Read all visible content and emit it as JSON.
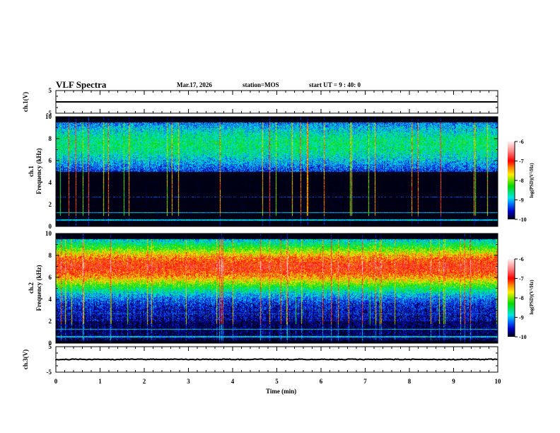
{
  "header": {
    "title": "VLF Spectra",
    "date": "Mar.17, 2026",
    "station": "station=MOS",
    "start": "start  UT =   9 : 40: 0"
  },
  "chart_data": [
    {
      "type": "line",
      "name": "ch1-waveform",
      "ylabel": "ch.1(V)",
      "ylim": [
        -5,
        5
      ],
      "yticks": [
        "5",
        "-5"
      ],
      "value_approx": 0
    },
    {
      "type": "heatmap",
      "name": "ch1-spectrogram",
      "ylabel": "ch.1\nFrequency (kHz)",
      "ylim": [
        0,
        10
      ],
      "yticks": [
        "0",
        "2",
        "4",
        "6",
        "8",
        "10"
      ],
      "band_khz": [
        5,
        9.5
      ],
      "colorbar": {
        "label": "log(PSD)(V²/Hz)",
        "range": [
          -10,
          -6
        ],
        "ticks": [
          "-6",
          "-7",
          "-8",
          "-9",
          "-10"
        ]
      }
    },
    {
      "type": "heatmap",
      "name": "ch2-spectrogram",
      "ylabel": "ch.2\nFrequency (kHz)",
      "ylim": [
        0,
        10
      ],
      "yticks": [
        "0",
        "2",
        "4",
        "6",
        "8",
        "10"
      ],
      "band_khz": [
        2,
        9.5
      ],
      "peak_khz": 7,
      "colorbar": {
        "label": "log(PSD)(V²/Hz)",
        "range": [
          -10,
          -6
        ],
        "ticks": [
          "-6",
          "-7",
          "-8",
          "-9",
          "-10"
        ]
      }
    },
    {
      "type": "line",
      "name": "ch3-waveform",
      "ylabel": "ch.3(V)",
      "ylim": [
        -5,
        5
      ],
      "yticks": [
        "5",
        "-5"
      ],
      "value_approx": 0
    }
  ],
  "xaxis": {
    "label": "Time  (min)",
    "xlim": [
      0,
      10
    ],
    "ticks": [
      "0",
      "1",
      "2",
      "3",
      "4",
      "5",
      "6",
      "7",
      "8",
      "9",
      "10"
    ]
  }
}
